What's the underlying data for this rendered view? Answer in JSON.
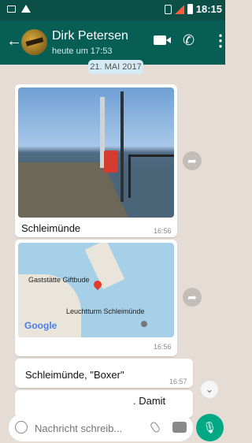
{
  "status": {
    "time": "18:15"
  },
  "header": {
    "contact": "Dirk Petersen",
    "last_seen": "heute um 17:53"
  },
  "date_pill": "21. MAI 2017",
  "messages": [
    {
      "type": "photo",
      "caption": "Schleimünde",
      "time": "16:56"
    },
    {
      "type": "map",
      "labels": [
        "Gaststätte Giftbude",
        "Leuchtturm Schleimünde"
      ],
      "time": "16:56"
    },
    {
      "type": "text",
      "text": "Schleimünde, \"Boxer\"",
      "time": "16:57"
    },
    {
      "type": "text",
      "text": ". Damit"
    }
  ],
  "composer": {
    "placeholder": "Nachricht schreib..."
  },
  "icons": [
    "back-arrow-icon",
    "avatar",
    "video-call-icon",
    "phone-icon",
    "more-icon",
    "forward-icon",
    "scroll-down-icon",
    "emoji-icon",
    "attach-icon",
    "camera-icon",
    "mic-icon"
  ]
}
